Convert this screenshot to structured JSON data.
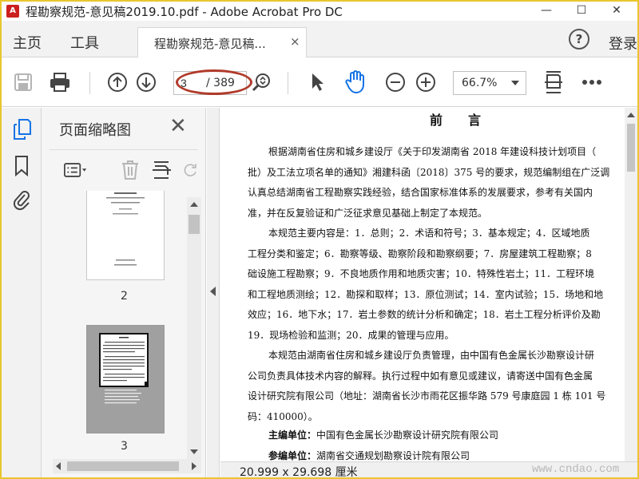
{
  "window": {
    "title": "程勘察规范-意见稿2019.10.pdf - Adobe Acrobat Pro DC",
    "minimize": "—",
    "maximize": "☐",
    "close": "✕"
  },
  "menubar": {
    "home": "主页",
    "tools": "工具",
    "tab_label": "程勘察规范-意见稿...",
    "tab_close": "×",
    "help": "?",
    "login": "登录"
  },
  "toolbar": {
    "current_page": "3",
    "total_pages": "/ 389",
    "zoom": "66.7%"
  },
  "thumbnails": {
    "title": "页面缩略图",
    "close": "✕",
    "pages": [
      {
        "label": "2"
      },
      {
        "label": "3"
      }
    ]
  },
  "document": {
    "heading": "前言",
    "lines": [
      {
        "text": "根据湖南省住房和城乡建设厅《关于印发湖南省 2018 年建设科技计划项目（",
        "indent": true
      },
      {
        "text": "批）及工法立项名单的通知》湘建科函〔2018〕375 号的要求，规范编制组在广泛调",
        "indent": false
      },
      {
        "text": "认真总结湖南省工程勘察实践经验，结合国家标准体系的发展要求，参考有关国内",
        "indent": false
      },
      {
        "text": "准，并在反复验证和广泛征求意见基础上制定了本规范。",
        "indent": false
      },
      {
        "text": "本规范主要内容是：1．总则；2．术语和符号；3．基本规定；4．区域地质",
        "indent": true
      },
      {
        "text": "工程分类和鉴定；6．勘察等级、勘察阶段和勘察纲要；7．房屋建筑工程勘察；8",
        "indent": false
      },
      {
        "text": "础设施工程勘察；9．不良地质作用和地质灾害；10．特殊性岩土；11．工程环境",
        "indent": false
      },
      {
        "text": "和工程地质测绘；12．勘探和取样；13．原位测试；14．室内试验；15．场地和地",
        "indent": false
      },
      {
        "text": "效应；16．地下水；17．岩土参数的统计分析和确定；18．岩土工程分析评价及勘",
        "indent": false
      },
      {
        "text": "19．现场检验和监测；20．成果的管理与应用。",
        "indent": false
      },
      {
        "text": "本规范由湖南省住房和城乡建设厅负责管理，由中国有色金属长沙勘察设计研",
        "indent": true
      },
      {
        "text": "公司负责具体技术内容的解释。执行过程中如有意见或建议，请寄送中国有色金属",
        "indent": false
      },
      {
        "text": "设计研究院有限公司（地址：湖南省长沙市雨花区振华路 579 号康庭园 1 栋 101 号",
        "indent": false
      },
      {
        "text": "码：410000）。",
        "indent": false
      }
    ],
    "chief_editor_label": "主编单位：",
    "chief_editor_value": "中国有色金属长沙勘察设计研究院有限公司",
    "co_editor_label": "参编单位：",
    "co_editor_value": "湖南省交通规划勘察设计院有限公司"
  },
  "status": {
    "dimensions": "20.999 x 29.698 厘米"
  },
  "watermark": {
    "text": "www.cndao.com"
  },
  "colors": {
    "accent_blue": "#1473e6",
    "annotation_red": "#b03a2a",
    "frame_yellow": "#e8c62e"
  }
}
